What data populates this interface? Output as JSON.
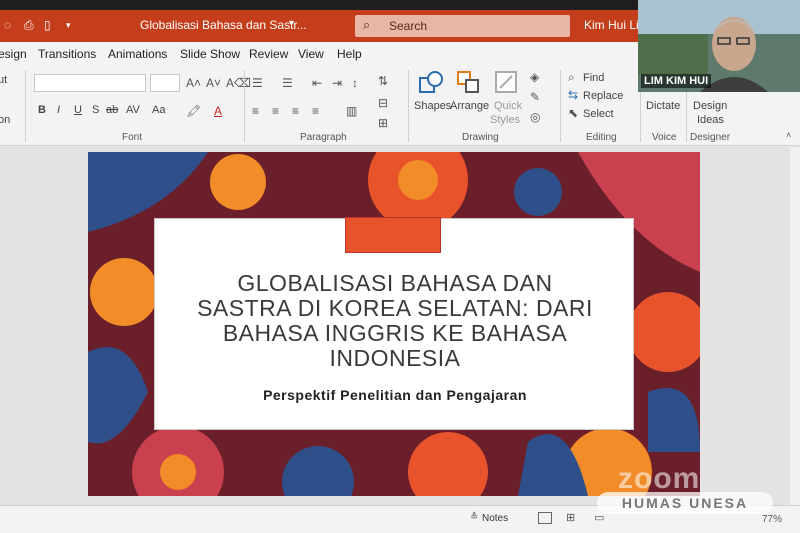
{
  "titlebar": {
    "document_title": "Globalisasi Bahasa dan Sastr...",
    "search_label": "Search",
    "user_name": "Kim Hui Lim"
  },
  "tabs": [
    "esign",
    "Transitions",
    "Animations",
    "Slide Show",
    "Review",
    "View",
    "Help"
  ],
  "ribbon": {
    "groups": {
      "font": "Font",
      "paragraph": "Paragraph",
      "drawing": "Drawing",
      "editing": "Editing",
      "voice": "Voice",
      "designer": "Designer"
    },
    "left_stub": [
      "ut",
      "on"
    ],
    "font_buttons": [
      "B",
      "I",
      "U",
      "S",
      "ab",
      "AV",
      "Aa"
    ],
    "drawing": {
      "shapes": "Shapes",
      "arrange": "Arrange",
      "quick_styles_1": "Quick",
      "quick_styles_2": "Styles"
    },
    "editing": {
      "find": "Find",
      "replace": "Replace",
      "select": "Select"
    },
    "voice": {
      "dictate": "Dictate"
    },
    "designer": {
      "design_ideas_1": "Design",
      "design_ideas_2": "Ideas"
    }
  },
  "webcam": {
    "participant_name": "LIM KIM HUI"
  },
  "slide": {
    "title_lines": [
      "GLOBALISASI BAHASA DAN",
      "SASTRA DI KOREA SELATAN: DARI",
      "BAHASA INGGRIS KE BAHASA",
      "INDONESIA"
    ],
    "subtitle": "Perspektif Penelitian dan Pengajaran",
    "accent_color": "#e8532b",
    "background_colors": [
      "#6b1f2a",
      "#e8532b",
      "#2e4f8a",
      "#f28c28",
      "#c9404f"
    ]
  },
  "statusbar": {
    "notes_label": "Notes",
    "zoom": "77%"
  },
  "watermark": {
    "zoom": "zoom",
    "humas": "HUMAS UNESA"
  }
}
